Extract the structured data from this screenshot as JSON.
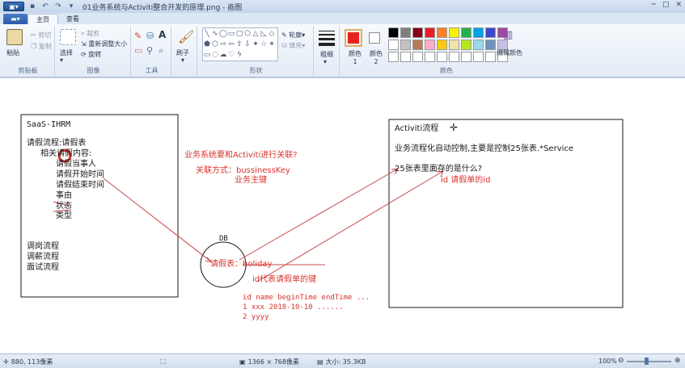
{
  "window": {
    "title": "01业务系统与Activiti整合开发的原理.png - 画图",
    "minimize": "─",
    "maximize": "□",
    "close": "✕"
  },
  "tabs": {
    "file": "▾",
    "home": "主页",
    "view": "查看"
  },
  "ribbon": {
    "clipboard": {
      "label": "剪贴板",
      "paste": "粘贴",
      "cut": "剪切",
      "copy": "复制"
    },
    "image": {
      "label": "图像",
      "select": "选择",
      "crop": "裁剪",
      "resize": "重新调整大小",
      "rotate": "旋转"
    },
    "tools": {
      "label": "工具"
    },
    "brushes": {
      "label": "刷子"
    },
    "shapes": {
      "label": "形状",
      "outline": "轮廓",
      "fill": "填充"
    },
    "size": {
      "label": "粗细"
    },
    "colors": {
      "label": "颜色",
      "color1": "颜色 1",
      "color2": "颜色 2",
      "edit": "编辑颜色",
      "color1_hex": "#e8221d",
      "color2_hex": "#ffffff",
      "palette": [
        "#000000",
        "#7f7f7f",
        "#880015",
        "#ed1c24",
        "#ff7f27",
        "#fff200",
        "#22b14c",
        "#00a2e8",
        "#3f48cc",
        "#a349a4",
        "#ffffff",
        "#c3c3c3",
        "#b97a57",
        "#ffaec9",
        "#ffc90e",
        "#efe4b0",
        "#b5e61d",
        "#99d9ea",
        "#7092be",
        "#c8bfe7",
        "#ffffff",
        "#ffffff",
        "#ffffff",
        "#ffffff",
        "#ffffff",
        "#ffffff",
        "#ffffff",
        "#ffffff",
        "#ffffff",
        "#ffffff"
      ]
    }
  },
  "canvas": {
    "left_box": {
      "title": "SaaS-IHRM",
      "lines": [
        "请假流程:请假表",
        "相关请假内容:",
        "请假当事人",
        "请假开始时间",
        "请假结束时间",
        "事由",
        "状态",
        "类型"
      ],
      "lines2": [
        "调岗流程",
        "调薪流程",
        "面试流程"
      ]
    },
    "middle": {
      "q1": "业务系统要和Activiti进行关联?",
      "q2": "关联方式：bussinessKey",
      "q3": "业务主键",
      "db": "DB",
      "table": "请假表：holiday",
      "id_note": "id代表请假单的键",
      "header": "id  name   beginTime  endTime  ...",
      "row1": "1   xxx    2018-10-10   ......",
      "row2": "2   yyyy"
    },
    "right_box": {
      "title": "Activiti流程",
      "line1": "业务流程化自动控制,主要是控制25张表.*Service",
      "line2": "25张表里面存的是什么?",
      "line3": "id  请假单的id"
    }
  },
  "status": {
    "cursor": "880, 113像素",
    "dimensions": "1366 × 768像素",
    "filesize": "大小: 35.3KB",
    "zoom": "100%",
    "zoom_minus": "⊖",
    "zoom_plus": "⊕"
  }
}
